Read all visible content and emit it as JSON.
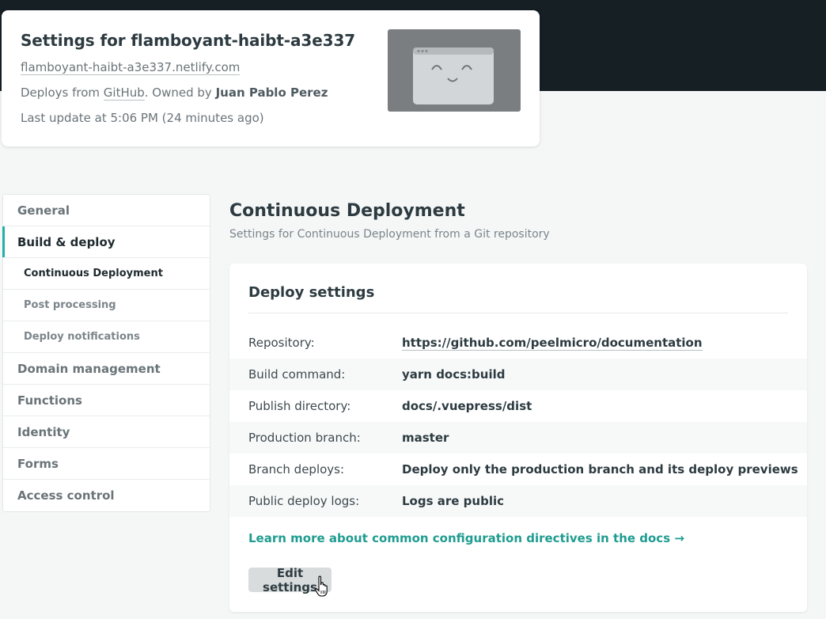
{
  "site": {
    "title": "Settings for flamboyant-haibt-a3e337",
    "url": "flamboyant-haibt-a3e337.netlify.com",
    "deploys_prefix": "Deploys from ",
    "provider": "GitHub",
    "owned_by_text": ". Owned by ",
    "owner": "Juan Pablo Perez",
    "last_update": "Last update at 5:06 PM (24 minutes ago)"
  },
  "sidebar": {
    "items": [
      {
        "label": "General"
      },
      {
        "label": "Build & deploy"
      },
      {
        "label": "Continuous Deployment"
      },
      {
        "label": "Post processing"
      },
      {
        "label": "Deploy notifications"
      },
      {
        "label": "Domain management"
      },
      {
        "label": "Functions"
      },
      {
        "label": "Identity"
      },
      {
        "label": "Forms"
      },
      {
        "label": "Access control"
      }
    ]
  },
  "main": {
    "title": "Continuous Deployment",
    "subtitle": "Settings for Continuous Deployment from a Git repository",
    "card": {
      "title": "Deploy settings",
      "rows": [
        {
          "key": "Repository:",
          "value": "https://github.com/peelmicro/documentation"
        },
        {
          "key": "Build command:",
          "value": "yarn docs:build"
        },
        {
          "key": "Publish directory:",
          "value": "docs/.vuepress/dist"
        },
        {
          "key": "Production branch:",
          "value": "master"
        },
        {
          "key": "Branch deploys:",
          "value": "Deploy only the production branch and its deploy previews"
        },
        {
          "key": "Public deploy logs:",
          "value": "Logs are public"
        }
      ],
      "docs_link": "Learn more about common configuration directives in the docs →",
      "edit_button": "Edit settings"
    }
  },
  "colors": {
    "accent": "#22b0a4",
    "link": "#1f9c90",
    "topbar": "#161f24"
  }
}
